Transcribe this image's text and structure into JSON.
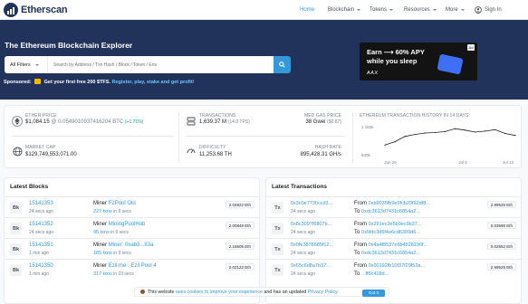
{
  "nav": {
    "brand": "Etherscan",
    "items": [
      {
        "label": "Home",
        "dropdown": false
      },
      {
        "label": "Blockchain",
        "dropdown": true
      },
      {
        "label": "Tokens",
        "dropdown": true
      },
      {
        "label": "Resources",
        "dropdown": true
      },
      {
        "label": "More",
        "dropdown": true
      }
    ],
    "sign_in": "Sign In"
  },
  "hero": {
    "title": "The Ethereum Blockchain Explorer",
    "filter_label": "All Filters",
    "search_placeholder": "Search by Address / Txn Hash / Block / Token / Ens"
  },
  "sponsored": {
    "label": "Sponsored:",
    "text": "Get your first free 200 $TFS.",
    "link": "Register, play, stake and get profit!"
  },
  "ad": {
    "line1": "Earn ⟶ 60% APY",
    "line2": "while you sleep",
    "brand": "AAX",
    "badge": "Ad"
  },
  "stats": {
    "ether_price": {
      "label": "Ether Price",
      "value": "$1,084.15",
      "btc": "@ 0.0549010937416204 BTC",
      "change": "(+1.71%)"
    },
    "market_cap": {
      "label": "Market Cap",
      "value": "$129,749,553,071.00"
    },
    "transactions": {
      "label": "Transactions",
      "value": "1,639.37 M",
      "tps": "(14.0 TPS)"
    },
    "gas": {
      "label": "Med Gas Price",
      "value": "38 Gwei",
      "usd": "($0.87)"
    },
    "difficulty": {
      "label": "Difficulty",
      "value": "11,253.68 TH"
    },
    "hashrate": {
      "label": "Hash Rate",
      "value": "895,428.31 GH/s"
    },
    "history": {
      "label": "Ethereum Transaction History in 14 Days"
    }
  },
  "chart_data": {
    "type": "line",
    "title": "Ethereum Transaction History in 14 Days",
    "x_ticks": [
      "Jun 29",
      "Jul 6",
      "Jul 13"
    ],
    "y_ticks": [
      "1 160k",
      "840k"
    ],
    "ylim": [
      840000,
      1160000
    ],
    "values": [
      950000,
      985000,
      1040000,
      1060000,
      1075000,
      1080000,
      1090000,
      1120000,
      1105000,
      1085000,
      1095000,
      1110000,
      1070000,
      1050000
    ],
    "color": "#1e2022"
  },
  "latest_blocks": {
    "title": "Latest Blocks",
    "rows": [
      {
        "badge": "Bk",
        "block": "15141353",
        "age": "24 secs ago",
        "miner_label": "Miner",
        "miner": "F2Pool Old",
        "txns": "227 txns",
        "txns_time": "in 9 secs",
        "reward": "2.04822 Eth"
      },
      {
        "badge": "Bk",
        "block": "15141352",
        "age": "24 secs ago",
        "miner_label": "Miner",
        "miner": "MiningPoolHub",
        "txns": "95 txns",
        "txns_time": "in 9 secs",
        "reward": "2.00848 Eth"
      },
      {
        "badge": "Bk",
        "block": "15141351",
        "age": "1 min ago",
        "miner_label": "Miner",
        "miner": "Miner: 0xab3...83a",
        "txns": "185 txns",
        "txns_time": "in 9 secs",
        "reward": "2.15505 Eth"
      },
      {
        "badge": "Bk",
        "block": "15141350",
        "age": "1 min ago",
        "miner_label": "Miner",
        "miner": "Ezil.me : Ezil Pool 4",
        "txns": "317 txns",
        "txns_time": "in 23 secs",
        "reward": "2.02122 Eth"
      }
    ]
  },
  "latest_transactions": {
    "title": "Latest Transactions",
    "rows": [
      {
        "badge": "Tx",
        "hash": "0x3c0e7730ccd3...",
        "age": "24 secs ago",
        "from_label": "From",
        "from": "0xb9035fb9e0fcb29f92df8...",
        "to_label": "To",
        "to": "0xdc3613d7431c6854a2...",
        "value": "2.99525 Eth"
      },
      {
        "badge": "Tx",
        "hash": "0x8c3097f6807b...",
        "age": "24 secs ago",
        "from_label": "From",
        "from": "0x291ec3e5b9ec9b37...",
        "to_label": "To",
        "to": "0x5fdc3d6f4e6cd6309d6...",
        "value": "0.03598 Eth"
      },
      {
        "badge": "Tx",
        "hash": "0x0fe3878685f12...",
        "age": "24 secs ago",
        "from_label": "From",
        "from": "0x4a4f8537e6b4828190f...",
        "to_label": "To",
        "to": "0xdc3613d7431c6854a2...",
        "value": "0.02552 Eth"
      },
      {
        "badge": "Tx",
        "hash": "0x65c6d8a7b37...",
        "age": "24 secs ago",
        "from_label": "From",
        "from": "0x00192fb10f37f29f52a...",
        "to_label": "To",
        "to": "...ff6c418d...",
        "value": "2.99525 Eth"
      }
    ]
  },
  "cookie": {
    "text1": "This website",
    "link1": "uses cookies to improve your experience",
    "text2": "and has an updated",
    "link2": "Privacy Policy.",
    "button": "Got It"
  }
}
